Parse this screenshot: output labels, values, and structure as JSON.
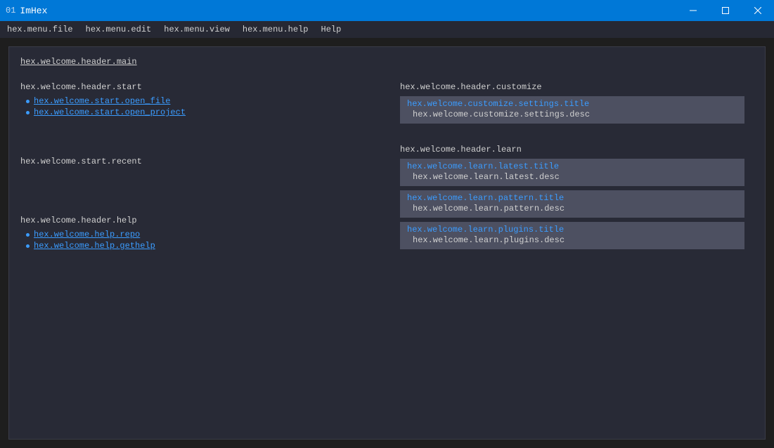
{
  "titlebar": {
    "num": "01",
    "title": "ImHex"
  },
  "menubar": {
    "file": "hex.menu.file",
    "edit": "hex.menu.edit",
    "view": "hex.menu.view",
    "help1": "hex.menu.help",
    "help2": "Help"
  },
  "welcome": {
    "header_main": "hex.welcome.header.main",
    "start": {
      "header": "hex.welcome.header.start",
      "open_file": "hex.welcome.start.open_file",
      "open_project": "hex.welcome.start.open_project",
      "recent": "hex.welcome.start.recent"
    },
    "help": {
      "header": "hex.welcome.header.help",
      "repo": "hex.welcome.help.repo",
      "gethelp": "hex.welcome.help.gethelp"
    },
    "customize": {
      "header": "hex.welcome.header.customize",
      "settings_title": "hex.welcome.customize.settings.title",
      "settings_desc": "hex.welcome.customize.settings.desc"
    },
    "learn": {
      "header": "hex.welcome.header.learn",
      "latest_title": "hex.welcome.learn.latest.title",
      "latest_desc": "hex.welcome.learn.latest.desc",
      "pattern_title": "hex.welcome.learn.pattern.title",
      "pattern_desc": "hex.welcome.learn.pattern.desc",
      "plugins_title": "hex.welcome.learn.plugins.title",
      "plugins_desc": "hex.welcome.learn.plugins.desc"
    }
  }
}
